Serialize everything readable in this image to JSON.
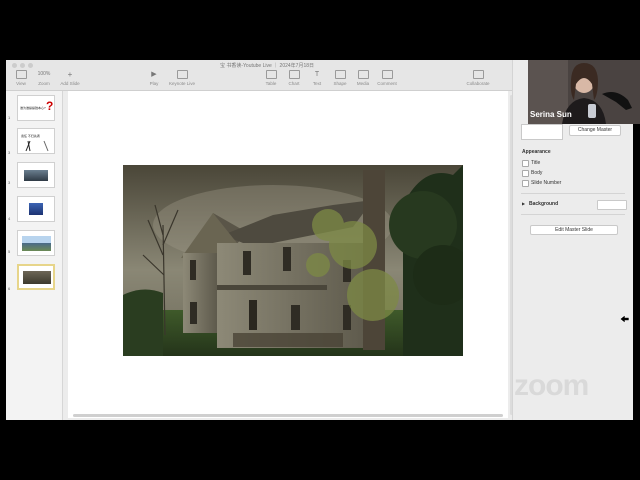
{
  "window": {
    "title": "宝 书香读-Youtube Live ｜ 2024年7月18日",
    "toolbar": {
      "zoom_value": "100%",
      "view": "View",
      "zoom": "Zoom",
      "add_slide": "Add Slide",
      "play": "Play",
      "keynote_live": "Keynote Live",
      "table": "Table",
      "chart": "Chart",
      "text": "Text",
      "shape": "Shape",
      "media": "Media",
      "comment": "Comment",
      "collaborate": "Collaborate"
    }
  },
  "navigator": {
    "slides": [
      {
        "number": "1",
        "caption": "谁为谁操操弛本心?"
      },
      {
        "number": "3",
        "caption": "责任 不归先者"
      },
      {
        "number": "3",
        "caption": ""
      },
      {
        "number": "4",
        "caption": ""
      },
      {
        "number": "5",
        "caption": ""
      },
      {
        "number": "6",
        "caption": ""
      }
    ]
  },
  "inspector": {
    "change_master": "Change Master",
    "appearance": "Appearance",
    "title": "Title",
    "body": "Body",
    "slide_number": "Slide Number",
    "background": "Background",
    "edit_master": "Edit Master Slide"
  },
  "video": {
    "participant_name": "Serina Sun"
  },
  "zoom_watermark": "zoom",
  "colors": {
    "selection_border": "#e7d58a",
    "window_bg": "#ececec"
  }
}
